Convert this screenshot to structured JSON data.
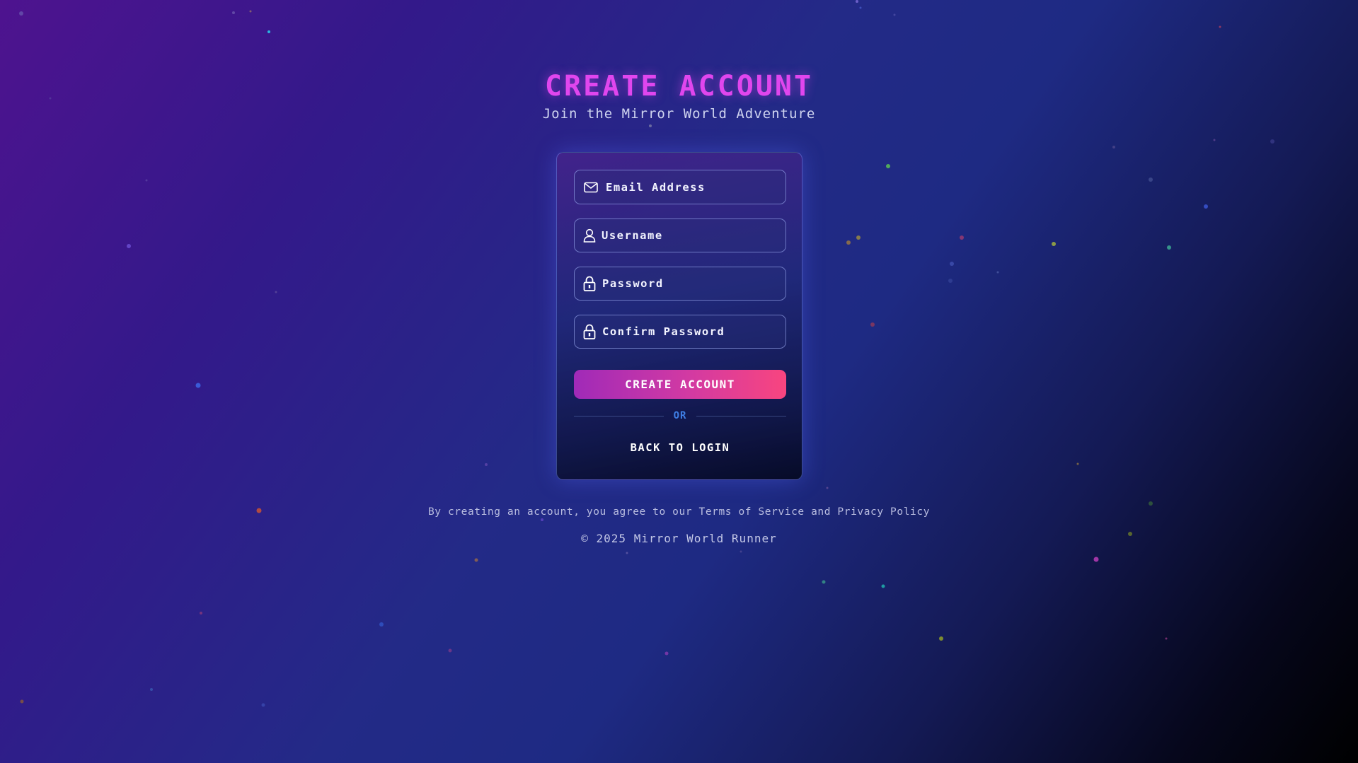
{
  "header": {
    "title": "CREATE ACCOUNT",
    "subtitle": "Join the Mirror World Adventure"
  },
  "form": {
    "fields": [
      {
        "icon": "envelope-icon",
        "placeholder": "Email Address",
        "value": ""
      },
      {
        "icon": "user-icon",
        "placeholder": "Username",
        "value": ""
      },
      {
        "icon": "lock-icon",
        "placeholder": "Password",
        "value": ""
      },
      {
        "icon": "lock-icon",
        "placeholder": "Confirm Password",
        "value": ""
      }
    ],
    "submit_label": "CREATE ACCOUNT",
    "divider_label": "OR",
    "back_label": "BACK TO LOGIN"
  },
  "footer": {
    "terms": "By creating an account, you agree to our Terms of Service and Privacy Policy",
    "copyright": "© 2025 Mirror World Runner"
  },
  "colors": {
    "title": "#e046ee",
    "button_start": "#a02ab8",
    "button_end": "#f8457f",
    "divider_text": "#3f7fe6"
  }
}
